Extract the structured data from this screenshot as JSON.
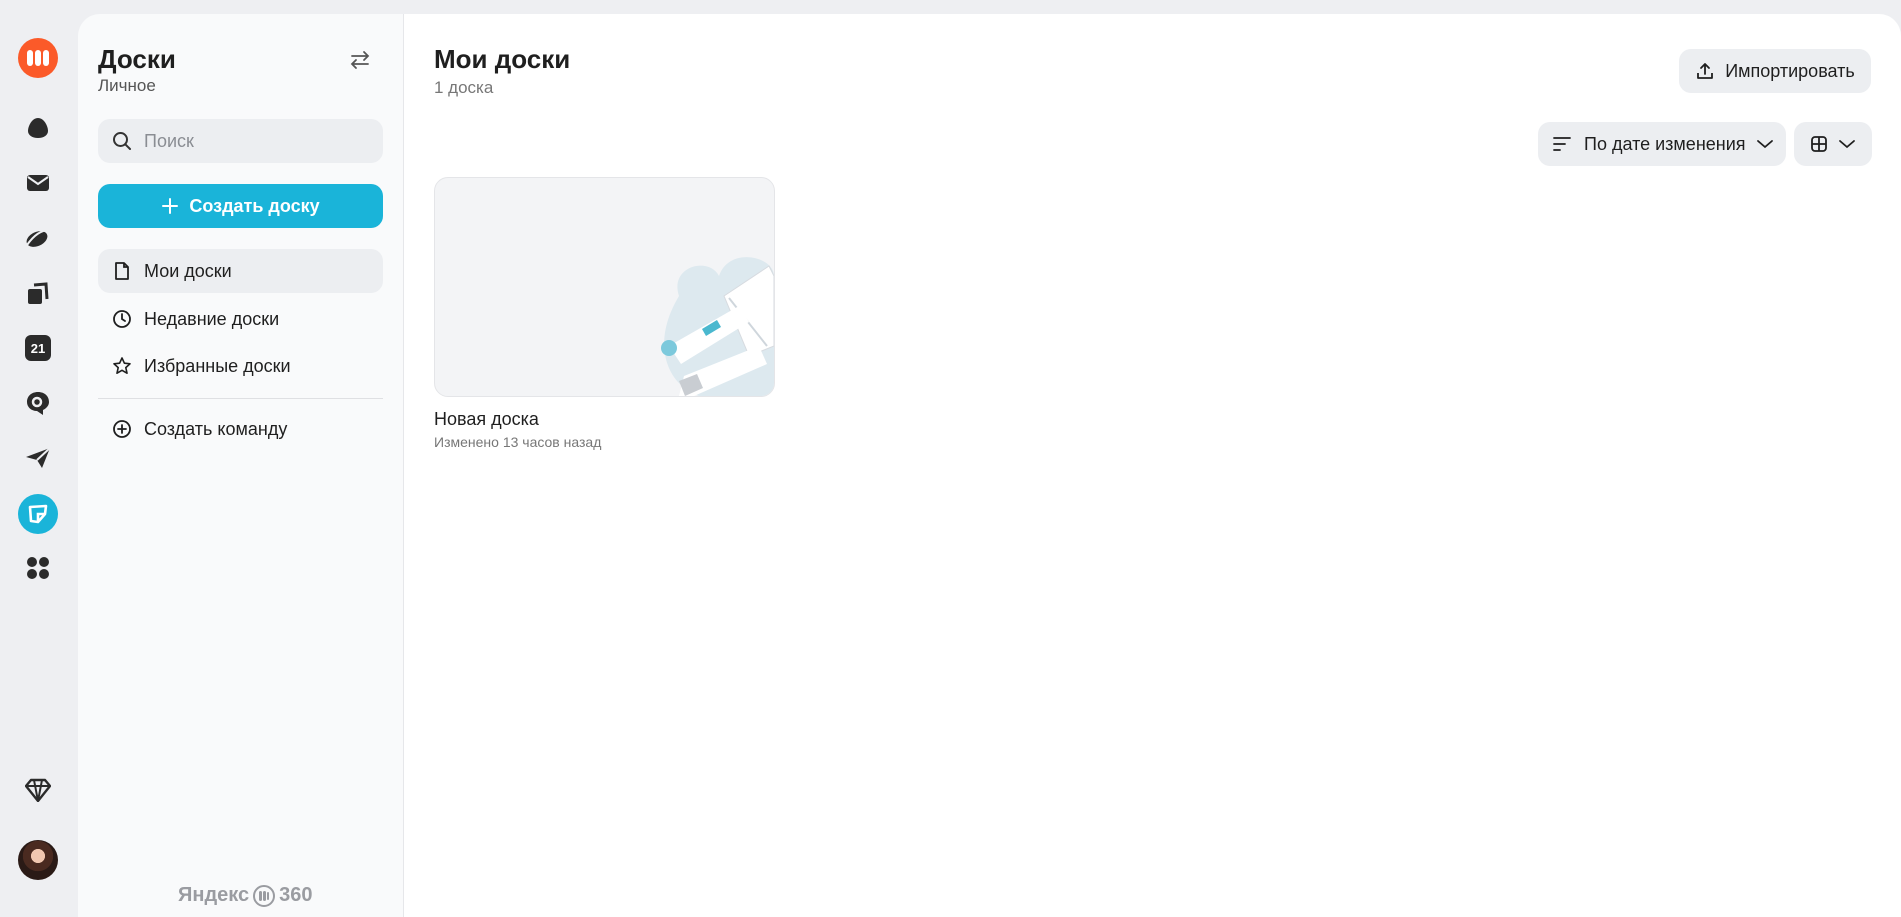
{
  "rail": {
    "icons": [
      "yandex-360-logo-icon",
      "cloud-icon",
      "mail-icon",
      "disk-icon",
      "documents-icon",
      "calendar-icon",
      "messenger-icon",
      "telemost-icon",
      "boards-icon",
      "apps-grid-icon",
      "premium-diamond-icon"
    ],
    "calendar_day": "21"
  },
  "sidebar": {
    "title": "Доски",
    "subtitle": "Личное",
    "search_placeholder": "Поиск",
    "create_label": "Создать доску",
    "items": [
      {
        "label": "Мои доски",
        "icon": "document-icon",
        "active": true
      },
      {
        "label": "Недавние доски",
        "icon": "clock-icon",
        "active": false
      },
      {
        "label": "Избранные доски",
        "icon": "star-icon",
        "active": false
      }
    ],
    "create_team_label": "Создать команду",
    "brand_left": "Яндекс",
    "brand_right": "360"
  },
  "main": {
    "title": "Мои доски",
    "count": "1 доска",
    "import_label": "Импортировать",
    "sort_label": "По дате изменения",
    "boards": [
      {
        "title": "Новая доска",
        "meta": "Изменено 13 часов назад"
      }
    ]
  },
  "colors": {
    "accent": "#1ab4d9",
    "logo": "#fb5a29",
    "background": "#eeeff2"
  }
}
